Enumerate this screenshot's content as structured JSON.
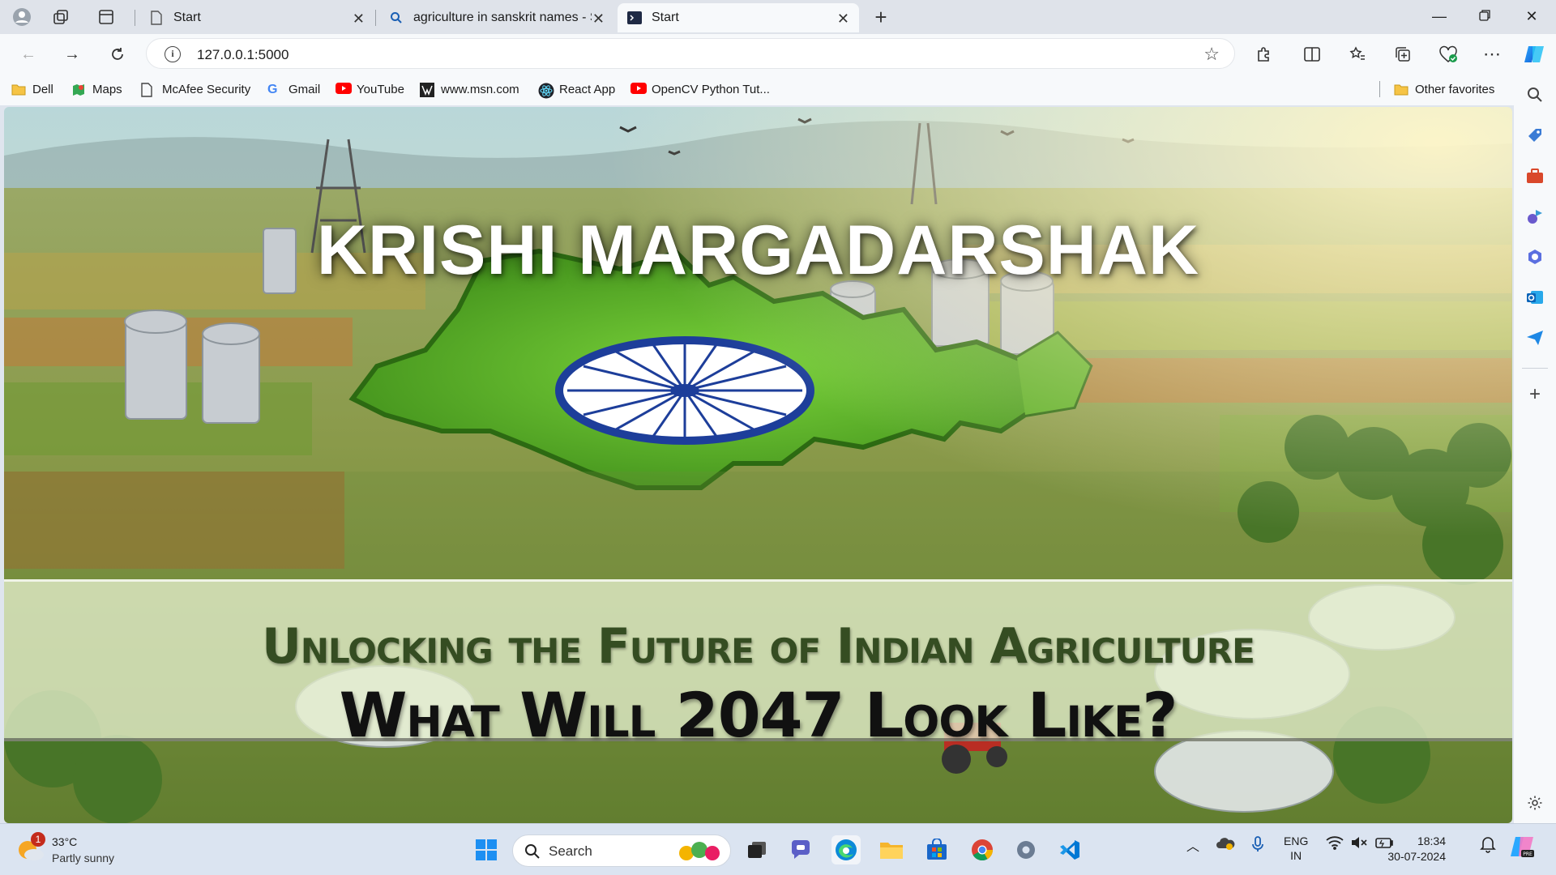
{
  "browser": {
    "tabs": [
      {
        "label": "Start"
      },
      {
        "label": "agriculture in sanskrit names - Se"
      },
      {
        "label": "Start"
      }
    ],
    "address": {
      "url": "127.0.0.1:5000"
    },
    "bookmarks": [
      {
        "label": "Dell"
      },
      {
        "label": "Maps"
      },
      {
        "label": "McAfee Security"
      },
      {
        "label": "Gmail"
      },
      {
        "label": "YouTube"
      },
      {
        "label": "www.msn.com"
      },
      {
        "label": "React App"
      },
      {
        "label": "OpenCV Python Tut..."
      }
    ],
    "other_favorites": "Other favorites"
  },
  "page": {
    "title": "KRISHI MARGADARSHAK",
    "subtitle_line1": "Unlocking the Future of Indian Agriculture",
    "subtitle_line2": "What Will 2047 Look Like?"
  },
  "taskbar": {
    "weather": {
      "temp": "33°C",
      "condition": "Partly sunny",
      "badge": "1"
    },
    "search_label": "Search",
    "lang_top": "ENG",
    "lang_bottom": "IN",
    "time": "18:34",
    "date": "30-07-2024"
  },
  "colors": {
    "accent": "#0b57d0",
    "band": "#e4eecd"
  }
}
